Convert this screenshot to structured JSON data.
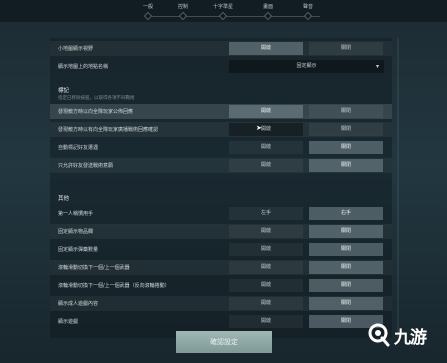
{
  "tabs": [
    {
      "label": "一般"
    },
    {
      "label": "控制"
    },
    {
      "label": "十字準星"
    },
    {
      "label": "畫面"
    },
    {
      "label": "聲音"
    }
  ],
  "rows_top": [
    {
      "label": "小地圖顯示視野",
      "a": "開啟",
      "b": "關閉",
      "a_on": true
    },
    {
      "label": "顯示地圖上的地點名稱",
      "dropdown": "固定顯示"
    }
  ],
  "section_mark": {
    "title": "標記",
    "subtitle": "指定已移除按鈕，以取得各項不同戰術"
  },
  "rows_mark": [
    {
      "label": "發現敵方時以向全隊玩家公佈回應",
      "a": "開啟",
      "b": "關閉",
      "a_on": true
    },
    {
      "label": "發現敵方時以有向全隊玩家廣播戰術回應確認",
      "a": "開啟",
      "b": "關閉",
      "a_on": false
    },
    {
      "label": "自動標記好友遭遇",
      "a": "開啟",
      "b": "關閉",
      "a_on": false
    },
    {
      "label": "只允許好友發送戰術意願",
      "a": "開啟",
      "b": "關閉",
      "a_on": false
    }
  ],
  "section_other": {
    "title": "其他"
  },
  "rows_other": [
    {
      "label": "第一人稱慣用手",
      "a": "左手",
      "b": "右手",
      "a_on": false
    },
    {
      "label": "固定顯示物品欄",
      "a": "開啟",
      "b": "關閉",
      "a_on": false
    },
    {
      "label": "固定顯示彈藥數量",
      "a": "開啟",
      "b": "關閉",
      "a_on": false
    },
    {
      "label": "滾輪滑動切換下一個/上一個武器",
      "a": "開啟",
      "b": "關閉",
      "a_on": false
    },
    {
      "label": "滾輪滑動切換下一個/上一個武器（反向滾輪捲動）",
      "a": "開啟",
      "b": "關閉",
      "a_on": false
    },
    {
      "label": "顯示成人遊戲內容",
      "a": "開啟",
      "b": "關閉",
      "a_on": false
    },
    {
      "label": "顯示遊戲",
      "a": "開啟",
      "b": "關閉",
      "a_on": false
    }
  ],
  "confirm_label": "確認設定",
  "watermark": {
    "text": "九游"
  }
}
